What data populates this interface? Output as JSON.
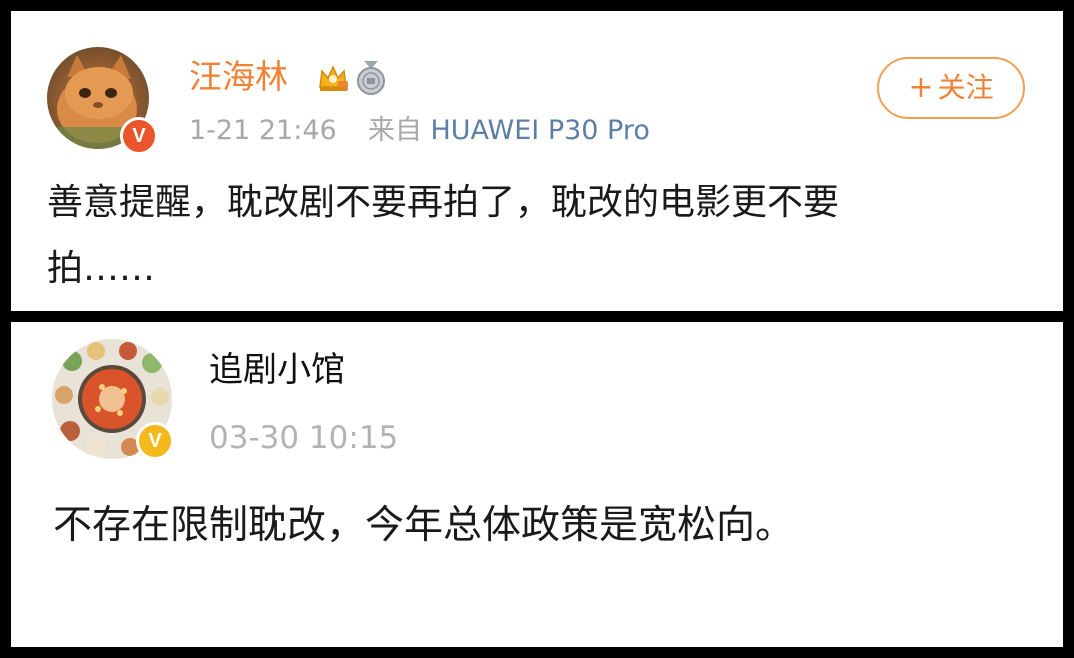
{
  "posts": [
    {
      "username": "汪海林",
      "timestamp": "1-21 21:46",
      "source_prefix": "来自",
      "source_device": "HUAWEI P30 Pro",
      "follow_label": "关注",
      "follow_plus": "+",
      "verified_badge": "V",
      "verified_color": "#e8562a",
      "username_color": "#f08235",
      "text_line1": "善意提醒，耽改剧不要再拍了，耽改的电影更不要",
      "text_line2": "拍……",
      "icons": [
        "crown-icon",
        "medal-icon",
        "verified-icon"
      ]
    },
    {
      "username": "追剧小馆",
      "timestamp": "03-30 10:15",
      "verified_badge": "V",
      "verified_color": "#f3b81c",
      "text": "不存在限制耽改，今年总体政策是宽松向。",
      "icons": [
        "verified-icon"
      ]
    }
  ]
}
